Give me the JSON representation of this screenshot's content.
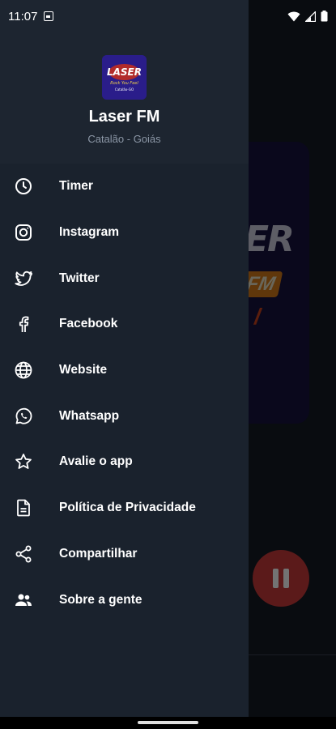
{
  "status_bar": {
    "time": "11:07"
  },
  "drawer": {
    "header": {
      "title": "Laser FM",
      "subtitle": "Catalão - Goiás",
      "logo_text": "LASER",
      "logo_tagline": "Rock You Feel",
      "logo_city": "Catalão-GO"
    },
    "items": [
      {
        "label": "Timer",
        "icon": "clock-icon"
      },
      {
        "label": "Instagram",
        "icon": "instagram-icon"
      },
      {
        "label": "Twitter",
        "icon": "twitter-icon"
      },
      {
        "label": "Facebook",
        "icon": "facebook-icon"
      },
      {
        "label": "Website",
        "icon": "globe-icon"
      },
      {
        "label": "Whatsapp",
        "icon": "whatsapp-icon"
      },
      {
        "label": "Avalie o app",
        "icon": "star-icon"
      },
      {
        "label": "Política de Privacidade",
        "icon": "document-icon"
      },
      {
        "label": "Compartilhar",
        "icon": "share-icon"
      },
      {
        "label": "Sobre a gente",
        "icon": "people-icon"
      }
    ]
  },
  "colors": {
    "drawer_bg": "#1a222d",
    "header_bg": "#1d2530",
    "accent_red": "#c93a3a",
    "subtitle": "#8c97a6"
  }
}
